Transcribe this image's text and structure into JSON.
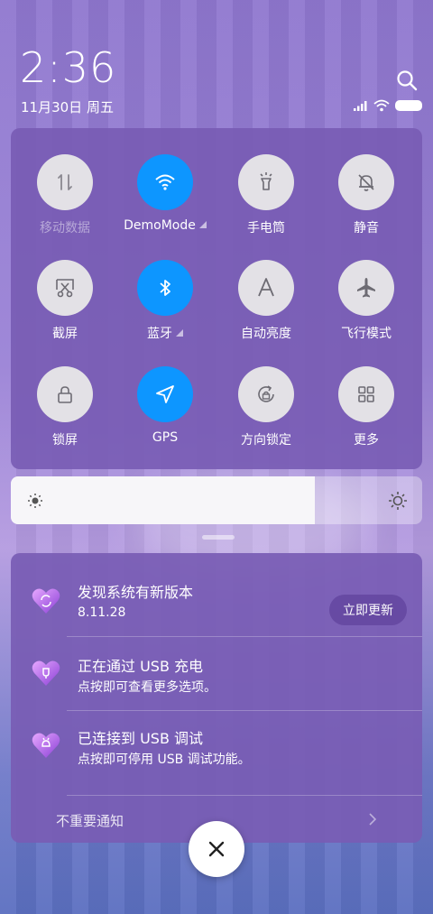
{
  "status": {
    "time": "2:36",
    "date": "11月30日 周五"
  },
  "quick_settings": {
    "tiles": [
      {
        "label": "移动数据",
        "active": false,
        "dimmed": true,
        "icon": "mobile-data-icon"
      },
      {
        "label": "DemoMode",
        "active": true,
        "has_menu": true,
        "icon": "wifi-icon"
      },
      {
        "label": "手电筒",
        "active": false,
        "icon": "flashlight-icon"
      },
      {
        "label": "静音",
        "active": false,
        "icon": "mute-bell-icon"
      },
      {
        "label": "截屏",
        "active": false,
        "icon": "screenshot-icon"
      },
      {
        "label": "蓝牙",
        "active": true,
        "has_menu": true,
        "icon": "bluetooth-icon"
      },
      {
        "label": "自动亮度",
        "active": false,
        "icon": "auto-brightness-icon"
      },
      {
        "label": "飞行模式",
        "active": false,
        "icon": "airplane-icon"
      },
      {
        "label": "锁屏",
        "active": false,
        "icon": "lock-icon"
      },
      {
        "label": "GPS",
        "active": true,
        "icon": "gps-icon"
      },
      {
        "label": "方向锁定",
        "active": false,
        "icon": "rotation-lock-icon"
      },
      {
        "label": "更多",
        "active": false,
        "icon": "more-grid-icon"
      }
    ]
  },
  "brightness": {
    "level": 0.74
  },
  "notifications": [
    {
      "title": "发现系统有新版本",
      "subtitle": "8.11.28",
      "action": "立即更新",
      "icon": "update-heart-icon"
    },
    {
      "title": "正在通过 USB 充电",
      "subtitle": "点按即可查看更多选项。",
      "icon": "usb-charge-heart-icon"
    },
    {
      "title": "已连接到 USB 调试",
      "subtitle": "点按即可停用 USB 调试功能。",
      "icon": "usb-debug-heart-icon"
    }
  ],
  "footer": {
    "unimportant_label": "不重要通知"
  },
  "colors": {
    "active_tile": "#0d96ff",
    "inactive_tile": "#e3e1e6",
    "panel": "#785cb4"
  }
}
